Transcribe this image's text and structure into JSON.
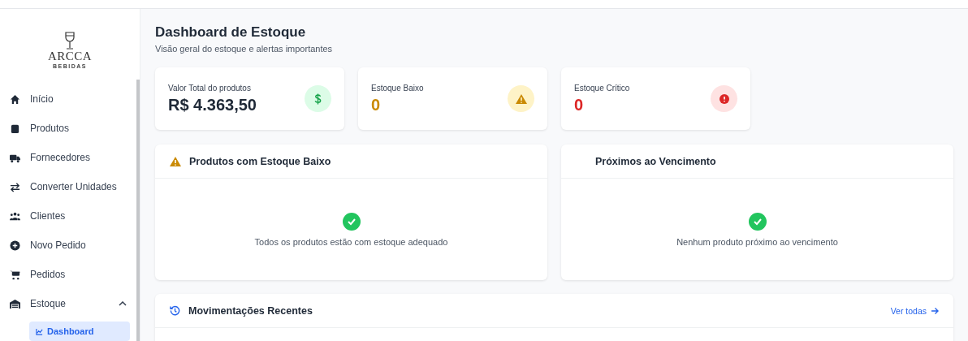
{
  "sidebar": {
    "logo": {
      "name": "ARCCA",
      "tagline": "BEBIDAS"
    },
    "items": [
      {
        "label": "Início",
        "kind": "home",
        "selected": false
      },
      {
        "label": "Produtos",
        "kind": "box",
        "selected": false
      },
      {
        "label": "Fornecedores",
        "kind": "truck",
        "selected": false
      },
      {
        "label": "Converter Unidades",
        "kind": "swap",
        "selected": false
      },
      {
        "label": "Clientes",
        "kind": "users",
        "selected": false
      },
      {
        "label": "Novo Pedido",
        "kind": "plus",
        "selected": false
      },
      {
        "label": "Pedidos",
        "kind": "cart",
        "selected": false
      },
      {
        "label": "Estoque",
        "kind": "warehouse",
        "selected": false,
        "expanded": true,
        "children": [
          {
            "label": "Dashboard",
            "kind": "chart",
            "selected": true
          }
        ]
      }
    ]
  },
  "header": {
    "title": "Dashboard de Estoque",
    "subtitle": "Visão geral do estoque e alertas importantes"
  },
  "stats": [
    {
      "label": "Valor Total do produtos",
      "value": "R$ 4.363,50",
      "kind": "money"
    },
    {
      "label": "Estoque Baixo",
      "value": "0",
      "kind": "warning"
    },
    {
      "label": "Estoque Crítico",
      "value": "0",
      "kind": "critical"
    }
  ],
  "panels": [
    {
      "title": "Produtos com Estoque Baixo",
      "kind": "warning",
      "message": "Todos os produtos estão com estoque adequado"
    },
    {
      "title": "Próximos ao Vencimento",
      "kind": "plain",
      "message": "Nenhum produto próximo ao vencimento"
    }
  ],
  "movements": {
    "title": "Movimentações Recentes",
    "link": "Ver todas"
  }
}
